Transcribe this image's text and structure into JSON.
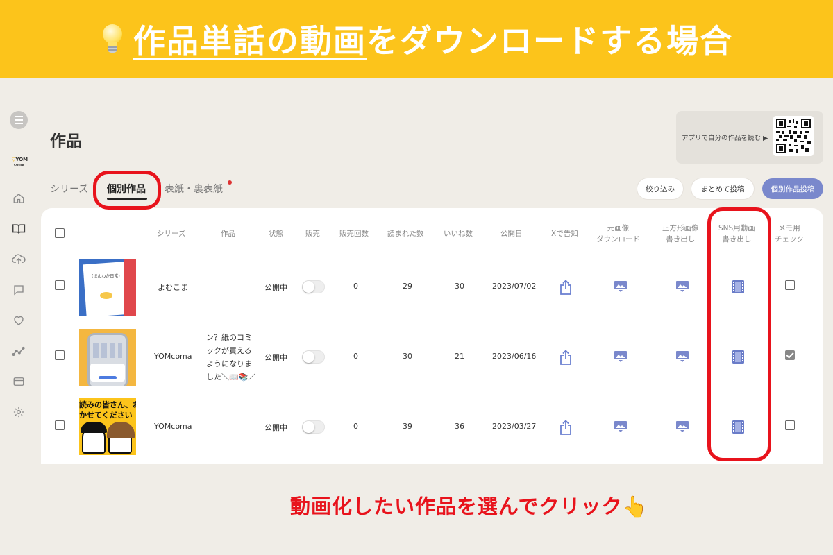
{
  "banner": {
    "title_underlined": "作品単話の動画",
    "title_rest": "をダウンロードする場合",
    "icon": "lightbulb-icon"
  },
  "logo": {
    "line1": "YOM",
    "line2": "coma"
  },
  "page": {
    "title": "作品"
  },
  "qr": {
    "text": "アプリで自分の作品を読む ▶"
  },
  "tabs": {
    "series": "シリーズ",
    "individual": "個別作品",
    "cover": "表紙・裏表紙"
  },
  "actions": {
    "filter": "絞り込み",
    "bulk_post": "まとめて投稿",
    "post": "個別作品投稿"
  },
  "columns": {
    "series": "シリーズ",
    "work": "作品",
    "status": "状態",
    "sale": "販売",
    "sales_count": "販売回数",
    "read_count": "読まれた数",
    "likes": "いいね数",
    "published": "公開日",
    "x_announce": "Xで告知",
    "download_l1": "元画像",
    "download_l2": "ダウンロード",
    "square_l1": "正方形画像",
    "square_l2": "書き出し",
    "sns_l1": "SNS用動画",
    "sns_l2": "書き出し",
    "memo_l1": "メモ用",
    "memo_l2": "チェック"
  },
  "rows": [
    {
      "series": "よむこま",
      "work": [],
      "status": "公開中",
      "sales_count": "0",
      "read_count": "29",
      "likes": "30",
      "published": "2023/07/02",
      "memo_checked": false,
      "thumb_caption": "(ほんわか日常)"
    },
    {
      "series": "YOMcoma",
      "work": [
        "ン？紙のコミ",
        "ックが買える",
        "ようになりま",
        "した＼📖📚／"
      ],
      "status": "公開中",
      "sales_count": "0",
      "read_count": "30",
      "likes": "21",
      "published": "2023/06/16",
      "memo_checked": true,
      "thumb_caption": ""
    },
    {
      "series": "YOMcoma",
      "work": [],
      "status": "公開中",
      "sales_count": "0",
      "read_count": "39",
      "likes": "36",
      "published": "2023/03/27",
      "memo_checked": false,
      "thumb_caption": "読みの皆さん、お",
      "thumb_caption2": "かせてください"
    }
  ],
  "callout": {
    "text": "動画化したい作品を選んでクリック👆"
  },
  "colors": {
    "banner": "#fcc41b",
    "accent": "#7a88cc",
    "highlight": "#e8131c"
  }
}
